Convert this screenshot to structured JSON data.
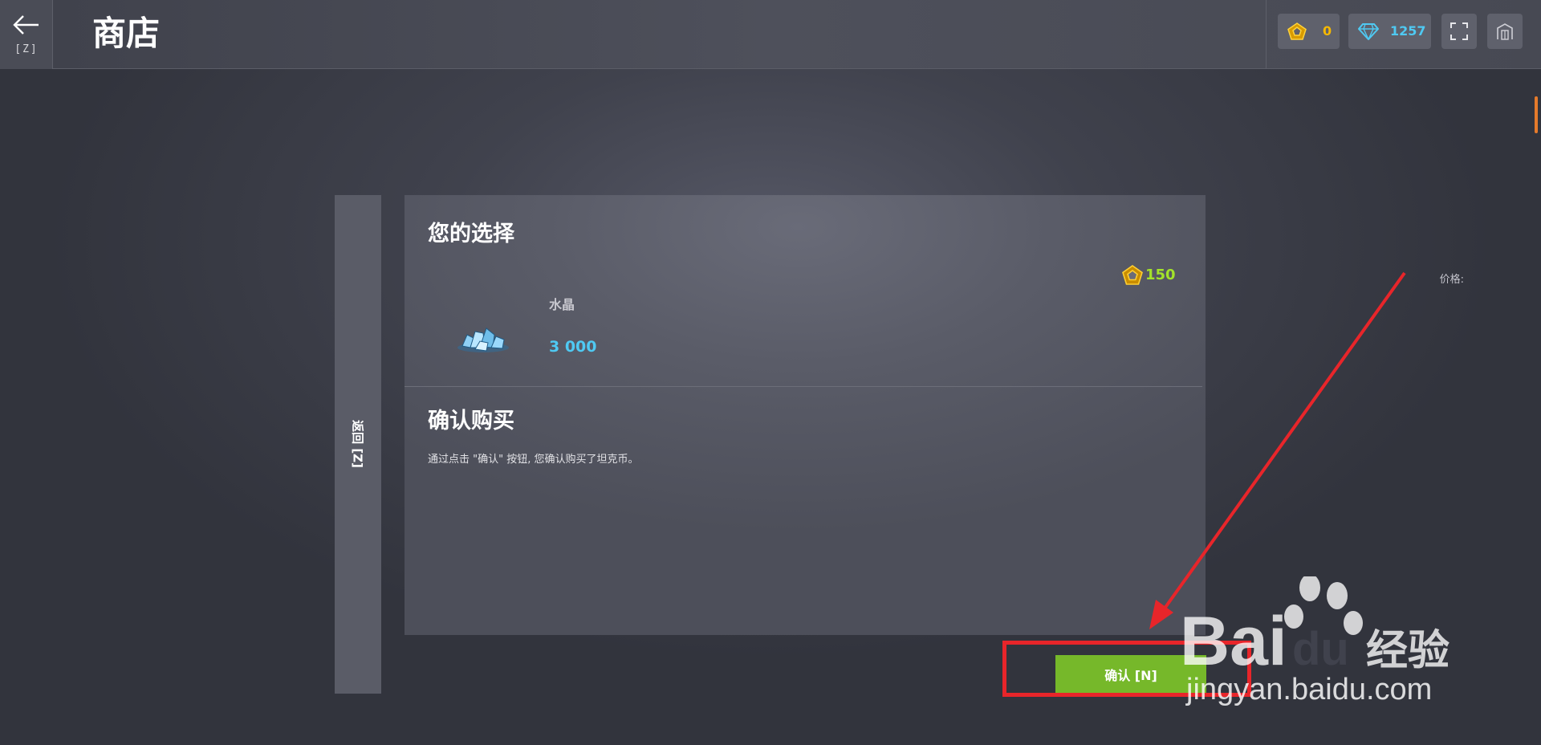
{
  "header": {
    "back_key": "[Z]",
    "title": "商店",
    "currencies": {
      "tankoins": {
        "value": "0",
        "color": "#f5b800",
        "icon": "pentagon-coin-icon"
      },
      "crystals": {
        "value": "1257",
        "color": "#4fc9f2",
        "icon": "diamond-icon"
      }
    },
    "fullscreen_icon": "fullscreen-icon",
    "garage_icon": "garage-icon"
  },
  "side_back": {
    "label": "返回 [Z]"
  },
  "selection": {
    "title": "您的选择",
    "price_label": "价格:",
    "price_value": "150",
    "item_name": "水晶",
    "item_amount": "3 000",
    "item_icon": "crystal-pile-icon"
  },
  "confirm_section": {
    "title": "确认购买",
    "description": "通过点击 \"确认\" 按钮, 您确认购买了坦克币。"
  },
  "confirm_button": {
    "label": "确认 [N]"
  },
  "watermark": {
    "brand": "Baidu经验",
    "url": "jingyan.baidu.com"
  },
  "colors": {
    "accent_green": "#76b82a",
    "price_green": "#a3e32a",
    "crystal_blue": "#4fc9f2",
    "coin_gold": "#f5b800",
    "annotation_red": "#e8252a",
    "scroll_orange": "#e57a2b"
  }
}
